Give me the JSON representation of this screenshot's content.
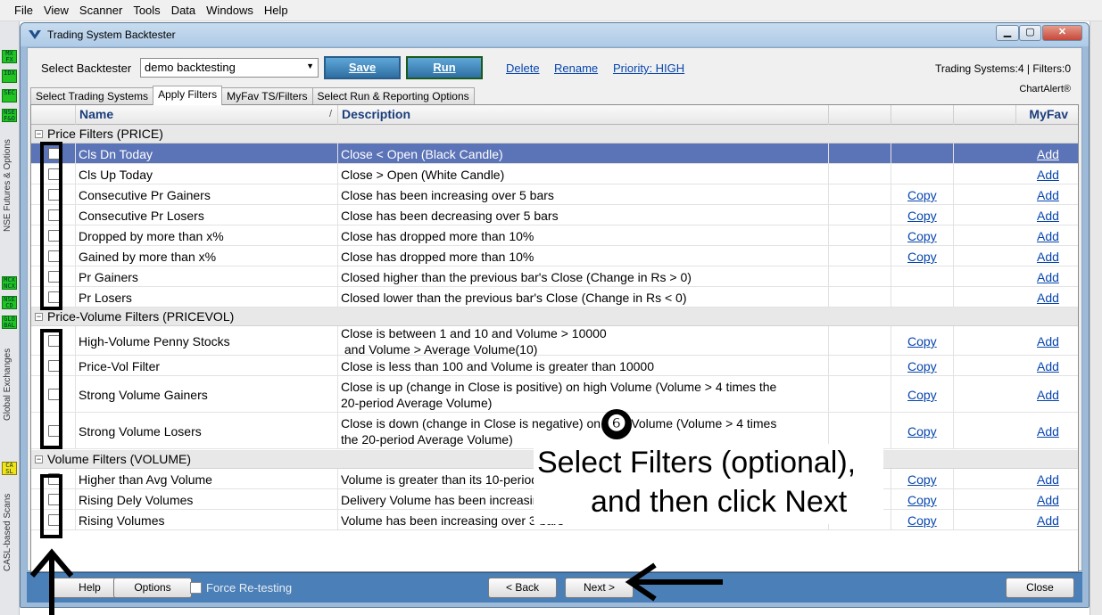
{
  "menu": [
    "File",
    "View",
    "Scanner",
    "Tools",
    "Data",
    "Windows",
    "Help"
  ],
  "left_strip": {
    "badges_top": [
      "MX FX",
      "IDX",
      "SEC",
      "NSE F&O"
    ],
    "label_top": "NSE Futures & Options",
    "badges_mid": [
      "MCX NCX",
      "NSE CD",
      "GLO BAL"
    ],
    "label_mid": "Global Exchanges",
    "badges_bot": [
      "CA SL"
    ],
    "label_bot": "CASL-based Scans"
  },
  "window": {
    "title": "Trading System Backtester"
  },
  "toolbar": {
    "select_label": "Select Backtester",
    "backtester_value": "demo backtesting",
    "save_label": "Save",
    "run_label": "Run",
    "delete_label": "Delete",
    "rename_label": "Rename",
    "priority_label": "Priority: HIGH",
    "stats": "Trading Systems:4 | Filters:0",
    "brand": "ChartAlert®"
  },
  "tabs": [
    "Select Trading Systems",
    "Apply Filters",
    "MyFav TS/Filters",
    "Select Run & Reporting Options"
  ],
  "grid": {
    "headers": {
      "name": "Name",
      "sort": "/",
      "description": "Description",
      "myfav": "MyFav"
    },
    "copy_label": "Copy",
    "add_label": "Add",
    "groups": [
      {
        "title": "Price Filters (PRICE)",
        "rows": [
          {
            "name": "Cls Dn Today",
            "desc": "Close < Open (Black Candle)",
            "copy": false
          },
          {
            "name": "Cls Up Today",
            "desc": "Close > Open (White Candle)",
            "copy": false
          },
          {
            "name": "Consecutive Pr Gainers",
            "desc": "Close has been increasing over 5 bars",
            "copy": true
          },
          {
            "name": "Consecutive Pr Losers",
            "desc": "Close has been decreasing over 5 bars",
            "copy": true
          },
          {
            "name": "Dropped by more than x%",
            "desc": "Close has dropped more than 10%",
            "copy": true
          },
          {
            "name": "Gained by more than x%",
            "desc": "Close has dropped more than 10%",
            "copy": true
          },
          {
            "name": "Pr Gainers",
            "desc": "Closed higher than the previous bar's Close (Change in Rs > 0)",
            "copy": false
          },
          {
            "name": "Pr Losers",
            "desc": "Closed lower than the previous bar's Close (Change in Rs < 0)",
            "copy": false
          }
        ]
      },
      {
        "title": "Price-Volume Filters (PRICEVOL)",
        "rows": [
          {
            "name": "High-Volume Penny Stocks",
            "desc1": "Close is between 1 and 10 and Volume > 10000",
            "desc2": " and Volume > Average Volume(10)",
            "copy": true
          },
          {
            "name": "Price-Vol Filter",
            "desc1": "Close is less than 100 and Volume is greater than 10000",
            "copy": true
          },
          {
            "name": "Strong Volume Gainers",
            "desc1": "Close is up (change in Close is positive) on high Volume (Volume > 4 times the",
            "desc2": "20-period Average Volume)",
            "copy": true
          },
          {
            "name": "Strong Volume Losers",
            "desc1": "Close is down (change in Close is negative) on high Volume (Volume > 4 times",
            "desc2": "the 20-period Average Volume)",
            "copy": true
          }
        ]
      },
      {
        "title": "Volume Filters (VOLUME)",
        "rows": [
          {
            "name": "Higher than Avg Volume",
            "desc": "Volume is greater than its 10-period Average Volume",
            "copy": true
          },
          {
            "name": "Rising Dely Volumes",
            "desc": "Delivery Volume has been increasing over 3 bars",
            "copy": true
          },
          {
            "name": "Rising Volumes",
            "desc": "Volume has been increasing over 3 bars",
            "copy": true
          }
        ]
      }
    ]
  },
  "bottom": {
    "help_label": "Help",
    "options_label": "Options",
    "force_label": "Force Re-testing",
    "back_label": "< Back",
    "next_label": "Next >",
    "close_label": "Close"
  },
  "callout": {
    "number": "❻",
    "line1": "Select Filters (optional),",
    "line2": "and then click Next"
  },
  "colors": {
    "selected_row": "#5b73b7",
    "bottom_bar": "#4a7fb7",
    "run_border": "#1a5a1a",
    "link": "#0645ad"
  }
}
